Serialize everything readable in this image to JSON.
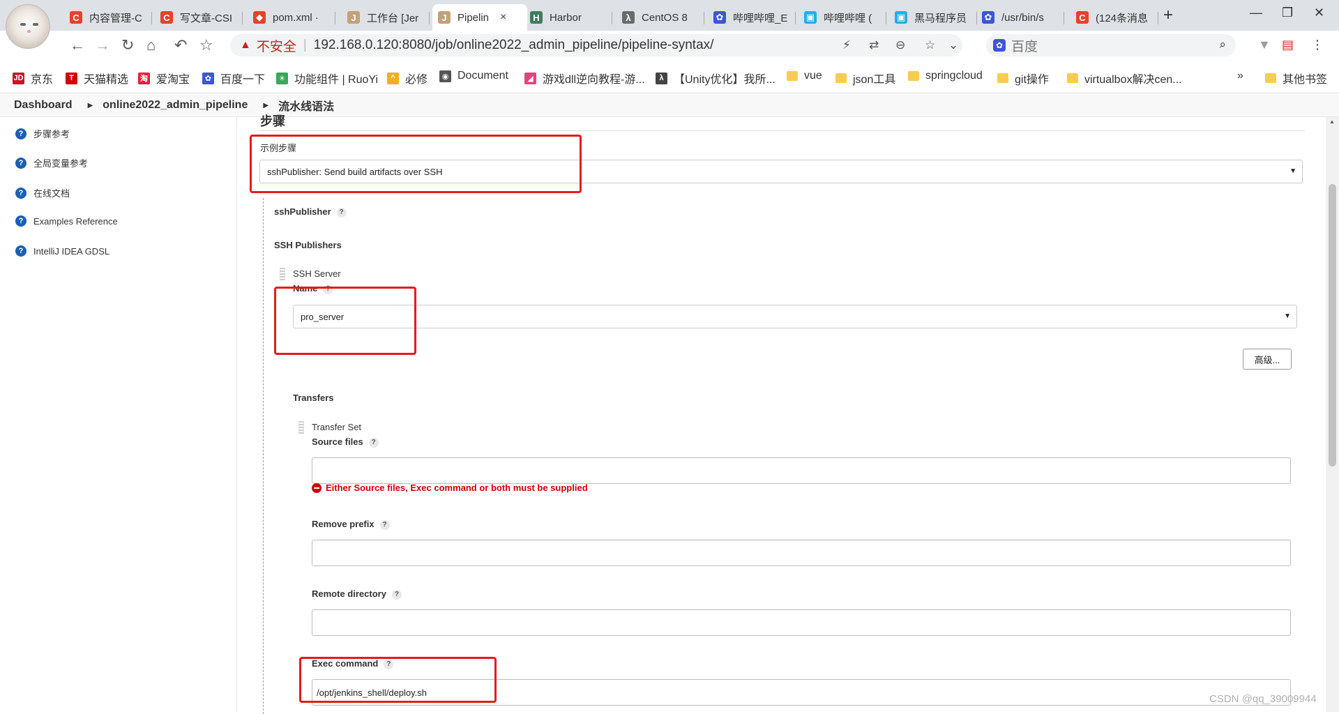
{
  "browser": {
    "tabs": [
      {
        "label": "内容管理-C",
        "icon": "csdn-icon",
        "color": "#e8412c",
        "glyph": "C"
      },
      {
        "label": "写文章-CSI",
        "icon": "csdn-icon",
        "color": "#e8412c",
        "glyph": "C"
      },
      {
        "label": "pom.xml ·",
        "icon": "gitlab-icon",
        "color": "#e24329",
        "glyph": "◆"
      },
      {
        "label": "工作台 [Jer",
        "icon": "jenkins-icon",
        "color": "#c3a07a",
        "glyph": "J"
      },
      {
        "label": "Pipelin",
        "icon": "jenkins-icon",
        "color": "#c3a07a",
        "glyph": "J",
        "active": true
      },
      {
        "label": "Harbor",
        "icon": "harbor-icon",
        "color": "#3f7c5f",
        "glyph": "H"
      },
      {
        "label": "CentOS 8",
        "icon": "centos-icon",
        "color": "#6b6b6b",
        "glyph": "λ"
      },
      {
        "label": "哔哩哔哩_E",
        "icon": "baidu-icon",
        "color": "#3d55d6",
        "glyph": "✿"
      },
      {
        "label": "哔哩哔哩 (",
        "icon": "bilibili-icon",
        "color": "#23aee5",
        "glyph": "▣"
      },
      {
        "label": "黑马程序员",
        "icon": "bilibili-icon",
        "color": "#23aee5",
        "glyph": "▣"
      },
      {
        "label": "/usr/bin/s",
        "icon": "baidu-icon",
        "color": "#3d55d6",
        "glyph": "✿"
      },
      {
        "label": "(124条消息",
        "icon": "csdn-icon",
        "color": "#e8412c",
        "glyph": "C"
      }
    ],
    "tab_close": "×",
    "new_tab": "+",
    "window_controls": {
      "minimize": "—",
      "maximize": "❐",
      "close": "✕"
    },
    "nav": {
      "back": "←",
      "forward": "→",
      "reload": "↻",
      "home": "⌂",
      "undo": "↶",
      "star": "☆"
    },
    "security_warning_icon": "▲",
    "insecure_label": "不安全",
    "separator": "|",
    "url": "192.168.0.120:8080/job/online2022_admin_pipeline/pipeline-syntax/",
    "search_placeholder": "百度",
    "search_icon": "⌕"
  },
  "bookmarks": [
    {
      "label": "京东",
      "icon": "jd-icon",
      "color": "#c81623",
      "glyph": "JD"
    },
    {
      "label": "天猫精选",
      "icon": "tmall-icon",
      "color": "#d00000",
      "glyph": "T"
    },
    {
      "label": "爱淘宝",
      "icon": "taobao-icon",
      "color": "#e3203c",
      "glyph": "淘"
    },
    {
      "label": "百度一下",
      "icon": "baidu-icon",
      "color": "#3d55d6",
      "glyph": "✿"
    },
    {
      "label": "功能组件 | RuoYi",
      "icon": "ruoyi-icon",
      "color": "#3aa65a",
      "glyph": "✳"
    },
    {
      "label": "必修",
      "icon": "bookmark-icon",
      "color": "#f2b01e",
      "glyph": "^"
    },
    {
      "label": "Document",
      "icon": "globe-icon",
      "color": "#555555",
      "glyph": "◉"
    },
    {
      "label": "游戏dll逆向教程-游...",
      "icon": "game-icon",
      "color": "#e0457b",
      "glyph": "◢"
    },
    {
      "label": "【Unity优化】我所...",
      "icon": "unity-icon",
      "color": "#444444",
      "glyph": "λ"
    },
    {
      "label": "vue",
      "icon": "folder-icon",
      "folder": true
    },
    {
      "label": "json工具",
      "icon": "folder-icon",
      "folder": true
    },
    {
      "label": "springcloud",
      "icon": "folder-icon",
      "folder": true
    },
    {
      "label": "git操作",
      "icon": "folder-icon",
      "folder": true
    },
    {
      "label": "virtualbox解决cen...",
      "icon": "folder-icon",
      "folder": true
    }
  ],
  "bookmarks_more": "»",
  "other_bookmarks": "其他书签",
  "breadcrumb": {
    "dashboard": "Dashboard",
    "job": "online2022_admin_pipeline",
    "page": "流水线语法"
  },
  "sidebar": {
    "items": [
      "步骤参考",
      "全局变量参考",
      "在线文档",
      "Examples Reference",
      "IntelliJ IDEA GDSL"
    ]
  },
  "form": {
    "section_title": "步骤",
    "sample_step_label": "示例步骤",
    "sample_step_value": "sshPublisher: Send build artifacts over SSH",
    "ssh_publisher_title": "sshPublisher",
    "help": "?",
    "ssh_publishers_title": "SSH Publishers",
    "ssh_server_label": "SSH Server",
    "name_label": "Name",
    "name_value": "pro_server",
    "advanced_button": "高级...",
    "transfers_title": "Transfers",
    "transfer_set_label": "Transfer Set",
    "source_files_label": "Source files",
    "source_files_value": "",
    "error_message": "Either Source files, Exec command or both must be supplied",
    "remove_prefix_label": "Remove prefix",
    "remove_prefix_value": "",
    "remote_directory_label": "Remote directory",
    "remote_directory_value": "",
    "exec_command_label": "Exec command",
    "exec_command_value": "/opt/jenkins_shell/deploy.sh",
    "dropdown_arrow": "▼"
  },
  "watermark": "CSDN @qq_39009944",
  "colors": {
    "highlight": "#e21c1c",
    "error": "#cc0000",
    "help_blue": "#1a5fb4"
  }
}
